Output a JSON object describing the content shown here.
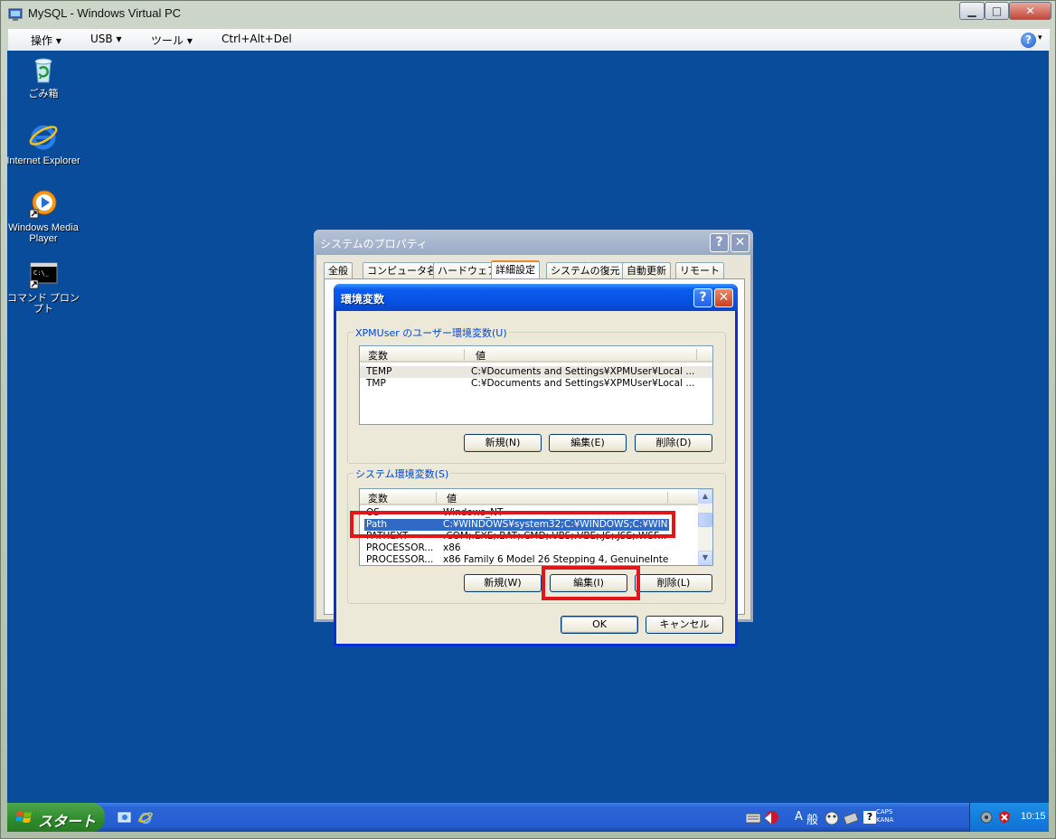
{
  "host": {
    "title": "MySQL - Windows Virtual PC",
    "controls": {
      "minimize": "▁",
      "maximize": "□",
      "close": "✕"
    },
    "menus": [
      "操作 ▾",
      "USB ▾",
      "ツール ▾",
      "Ctrl+Alt+Del"
    ],
    "help": "?",
    "help_drop": "▾"
  },
  "desktop": {
    "icons": [
      {
        "label": "ごみ箱",
        "icon": "recycle-bin-icon"
      },
      {
        "label": "Internet Explorer",
        "icon": "internet-explorer-icon"
      },
      {
        "label": "Windows Media Player",
        "icon": "media-player-icon"
      },
      {
        "label": "コマンド プロンプト",
        "icon": "command-prompt-icon"
      }
    ]
  },
  "taskbar": {
    "start_label": "スタート",
    "ime": {
      "mode": "A",
      "input": "般"
    },
    "caps": "CAPS",
    "kana": "KANA",
    "clock": "10:15"
  },
  "sysprops": {
    "title": "システムのプロパティ",
    "tabs": [
      "全般",
      "コンピュータ名",
      "ハードウェア",
      "詳細設定",
      "システムの復元",
      "自動更新",
      "リモート"
    ],
    "active_tab": "詳細設定"
  },
  "envdlg": {
    "title": "環境変数",
    "user_group": "XPMUser のユーザー環境変数(U)",
    "system_group": "システム環境変数(S)",
    "col_var": "変数",
    "col_val": "値",
    "user_vars": [
      {
        "name": "TEMP",
        "value": "C:¥Documents and Settings¥XPMUser¥Local ..."
      },
      {
        "name": "TMP",
        "value": "C:¥Documents and Settings¥XPMUser¥Local ..."
      }
    ],
    "system_vars": [
      {
        "name": "OS",
        "value": "Windows_NT"
      },
      {
        "name": "Path",
        "value": "C:¥WINDOWS¥system32;C:¥WINDOWS;C:¥WIN..."
      },
      {
        "name": "PATHEXT",
        "value": ".COM;.EXE;.BAT;.CMD;.VBS;.VBE;.JS;.JSE;.WSF..."
      },
      {
        "name": "PROCESSOR...",
        "value": "x86"
      },
      {
        "name": "PROCESSOR...",
        "value": "x86 Family 6 Model 26 Stepping 4, GenuineIntel"
      }
    ],
    "selected_var": "Path",
    "user_buttons": {
      "new": "新規(N)",
      "edit": "編集(E)",
      "delete": "削除(D)"
    },
    "system_buttons": {
      "new": "新規(W)",
      "edit": "編集(I)",
      "delete": "削除(L)"
    },
    "ok": "OK",
    "cancel": "キャンセル"
  },
  "colors": {
    "desktop_bg": "#0a4c9c",
    "xp_title_blue": "#0650e0",
    "highlight": "#316ac5",
    "annotation_red": "#e0161c"
  }
}
